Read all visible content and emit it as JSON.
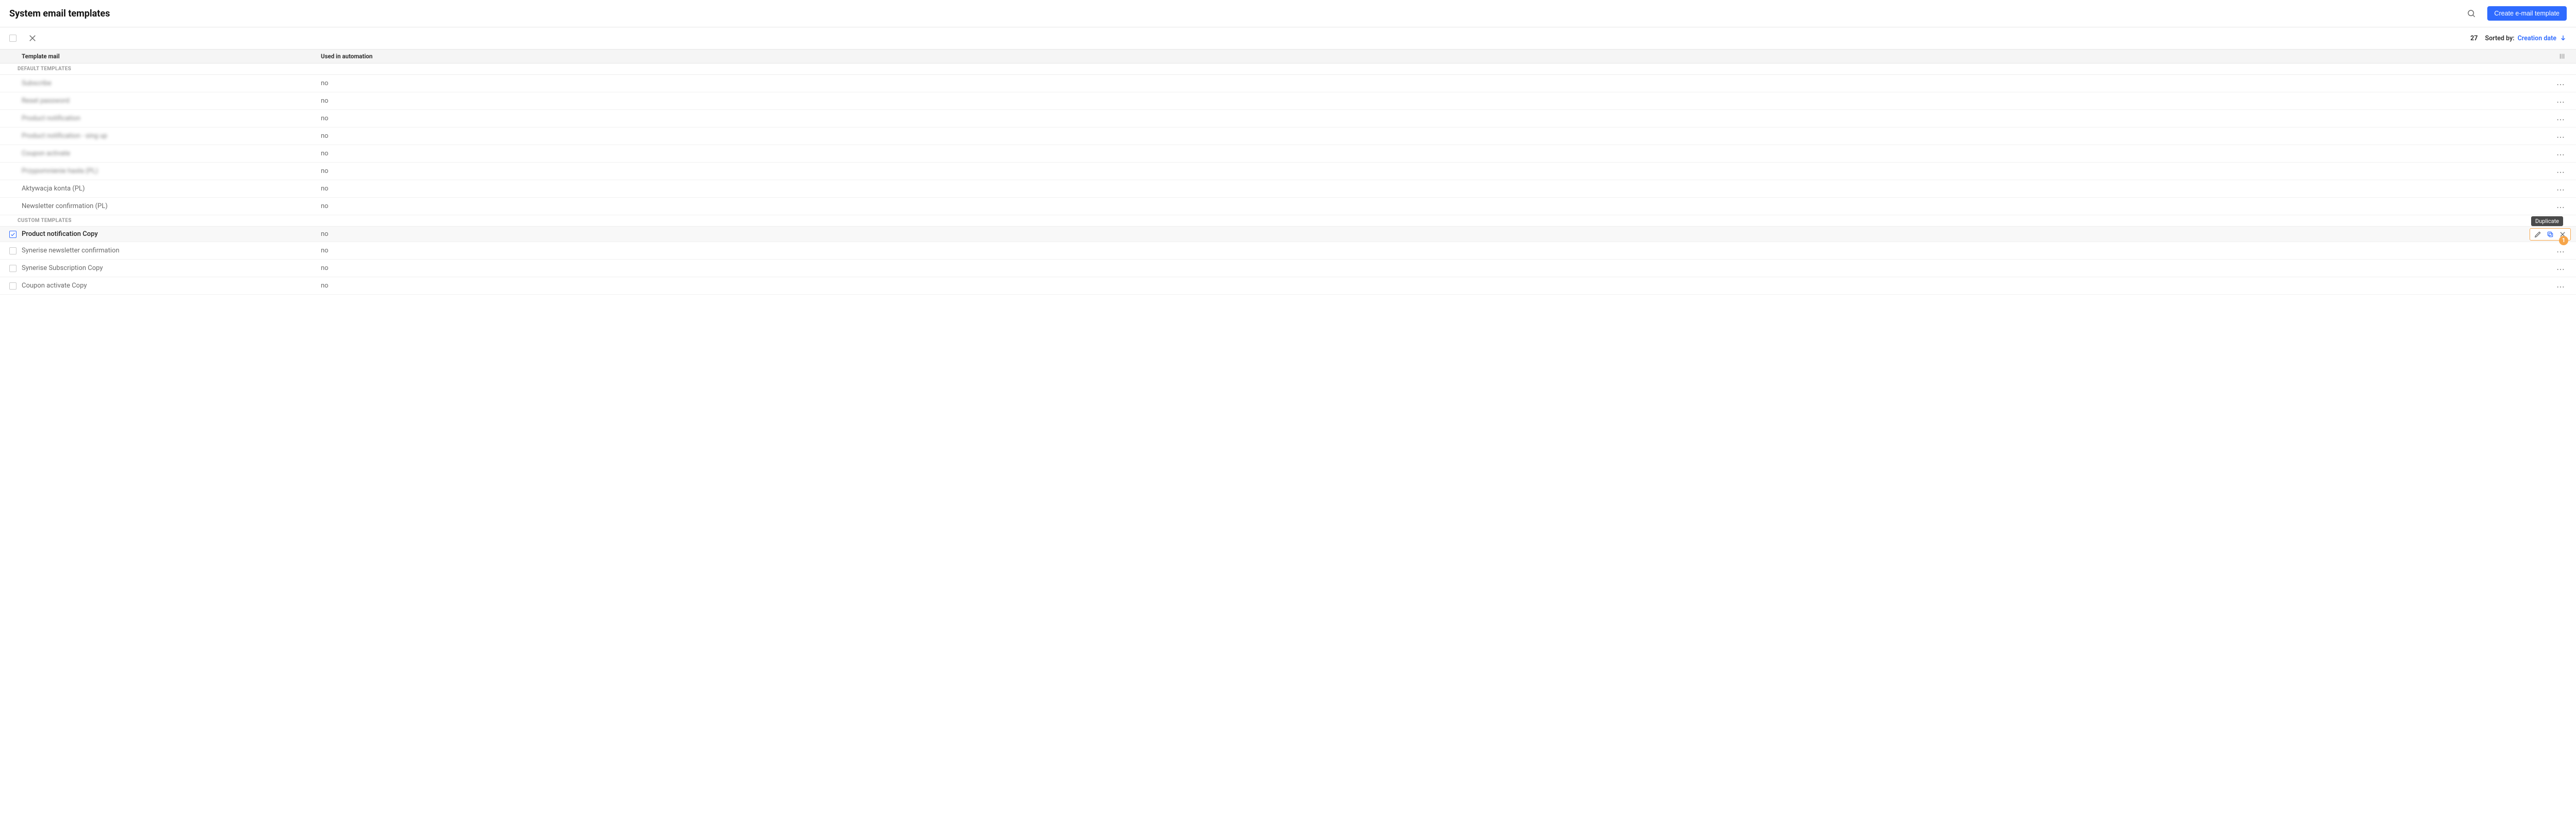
{
  "header": {
    "title": "System email templates",
    "create_button": "Create e-mail template"
  },
  "toolbar": {
    "count": "27",
    "sorted_by_label": "Sorted by:",
    "sort_field": "Creation date"
  },
  "columns": {
    "template_mail": "Template mail",
    "used_in_automation": "Used in automation"
  },
  "sections": {
    "default": "DEFAULT TEMPLATES",
    "custom": "CUSTOM TEMPLATES"
  },
  "default_rows": [
    {
      "name": "Subscribe",
      "auto": "no",
      "blurred": true
    },
    {
      "name": "Reset password",
      "auto": "no",
      "blurred": true
    },
    {
      "name": "Product notification",
      "auto": "no",
      "blurred": true
    },
    {
      "name": "Product notification - sing up",
      "auto": "no",
      "blurred": true
    },
    {
      "name": "Coupon activate",
      "auto": "no",
      "blurred": true
    },
    {
      "name": "Przypomnienie hasła (PL)",
      "auto": "no",
      "blurred": true
    },
    {
      "name": "Aktywacja konta (PL)",
      "auto": "no",
      "blurred": false
    },
    {
      "name": "Newsletter confirmation (PL)",
      "auto": "no",
      "blurred": false
    }
  ],
  "custom_rows": [
    {
      "name": "Product notification Copy",
      "auto": "no",
      "selected": true
    },
    {
      "name": "Synerise newsletter confirmation",
      "auto": "no",
      "selected": false
    },
    {
      "name": "Synerise Subscription Copy",
      "auto": "no",
      "selected": false
    },
    {
      "name": "Coupon activate Copy",
      "auto": "no",
      "selected": false
    }
  ],
  "tooltip": "Duplicate",
  "badge": "1"
}
